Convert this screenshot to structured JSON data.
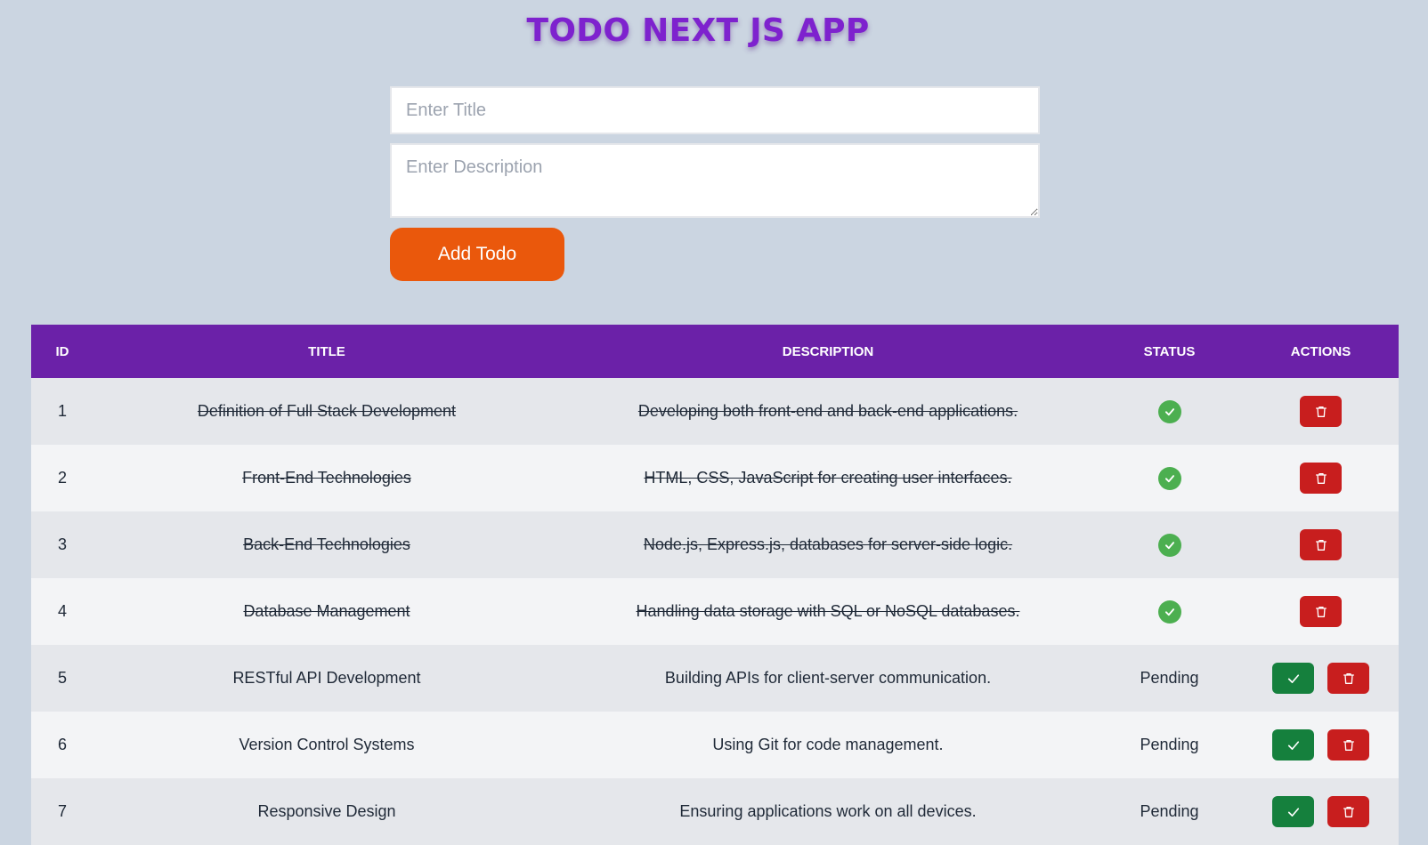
{
  "app": {
    "title": "TODO NEXT JS APP"
  },
  "form": {
    "title_placeholder": "Enter Title",
    "description_placeholder": "Enter Description",
    "add_button_label": "Add Todo"
  },
  "table": {
    "headers": {
      "id": "ID",
      "title": "TITLE",
      "description": "DESCRIPTION",
      "status": "STATUS",
      "actions": "ACTIONS"
    },
    "rows": [
      {
        "id": "1",
        "title": "Definition of Full Stack Development",
        "description": "Developing both front-end and back-end applications.",
        "completed": true,
        "status": ""
      },
      {
        "id": "2",
        "title": "Front-End Technologies",
        "description": "HTML, CSS, JavaScript for creating user interfaces.",
        "completed": true,
        "status": ""
      },
      {
        "id": "3",
        "title": "Back-End Technologies",
        "description": "Node.js, Express.js, databases for server-side logic.",
        "completed": true,
        "status": ""
      },
      {
        "id": "4",
        "title": "Database Management",
        "description": "Handling data storage with SQL or NoSQL databases.",
        "completed": true,
        "status": ""
      },
      {
        "id": "5",
        "title": "RESTful API Development",
        "description": "Building APIs for client-server communication.",
        "completed": false,
        "status": "Pending"
      },
      {
        "id": "6",
        "title": "Version Control Systems",
        "description": "Using Git for code management.",
        "completed": false,
        "status": "Pending"
      },
      {
        "id": "7",
        "title": "Responsive Design",
        "description": "Ensuring applications work on all devices.",
        "completed": false,
        "status": "Pending"
      }
    ]
  },
  "icons": {
    "completed_status": "check-circle-icon",
    "complete_action": "check-icon",
    "delete_action": "trash-icon"
  },
  "colors": {
    "background": "#cbd5e1",
    "title": "#7e22ce",
    "add_button": "#ea580c",
    "table_header": "#6b21a8",
    "completed_badge": "#4caf50",
    "complete_button": "#15803d",
    "delete_button": "#c81e1e"
  }
}
